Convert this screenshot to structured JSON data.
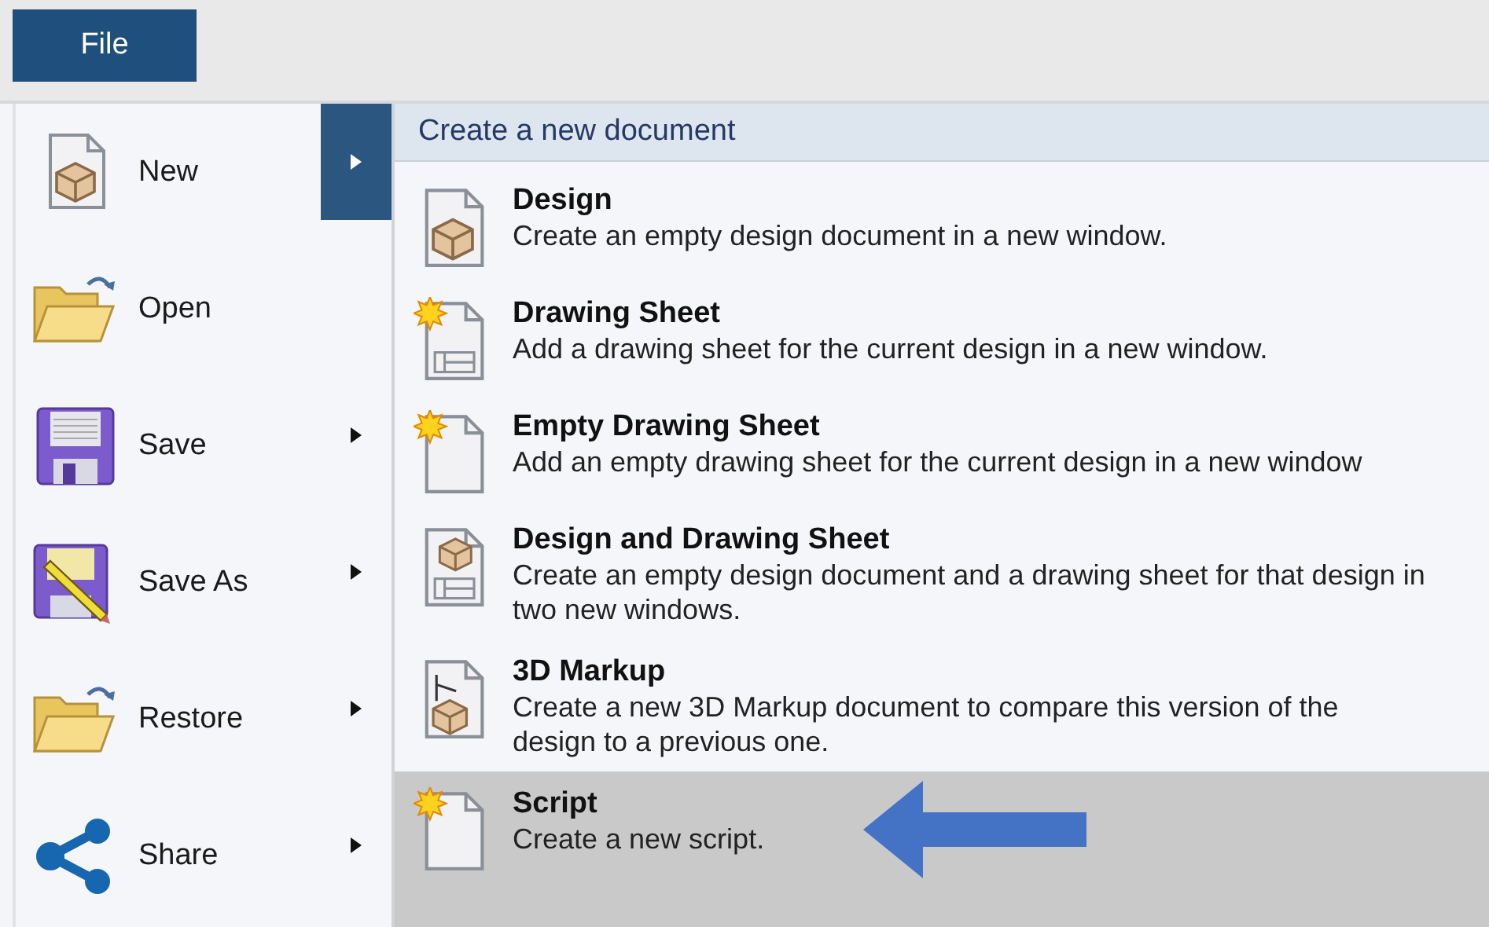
{
  "menu_tab": {
    "label": "File",
    "selected": true
  },
  "menu_items": [
    {
      "label": "New",
      "kind": "new",
      "submenu": true,
      "selected": true
    },
    {
      "label": "Open",
      "kind": "open",
      "submenu": false,
      "selected": false
    },
    {
      "label": "Save",
      "kind": "save",
      "submenu": true,
      "selected": false
    },
    {
      "label": "Save As",
      "kind": "saveas",
      "submenu": true,
      "selected": false
    },
    {
      "label": "Restore",
      "kind": "open",
      "submenu": true,
      "selected": false
    },
    {
      "label": "Share",
      "kind": "share",
      "submenu": true,
      "selected": false
    }
  ],
  "submenu": {
    "header": "Create a new document",
    "items": [
      {
        "title": "Design",
        "description": "Create an empty design document in a new window.",
        "kind": "design",
        "selected": false
      },
      {
        "title": "Drawing Sheet",
        "description": "Add a drawing sheet for the current design in a new window.",
        "kind": "sheet",
        "selected": false
      },
      {
        "title": "Empty Drawing Sheet",
        "description": "Add an empty drawing sheet for the current design in a new window",
        "kind": "blank",
        "selected": false
      },
      {
        "title": "Design and Drawing Sheet",
        "description": "Create an empty design document and a drawing sheet for that design in two new windows.",
        "kind": "both",
        "selected": false
      },
      {
        "title": "3D Markup",
        "description": "Create a new 3D Markup document to compare this version of the design to a previous one.",
        "kind": "markup",
        "selected": false
      },
      {
        "title": "Script",
        "description": "Create a new script.",
        "kind": "blank",
        "selected": true
      }
    ]
  }
}
